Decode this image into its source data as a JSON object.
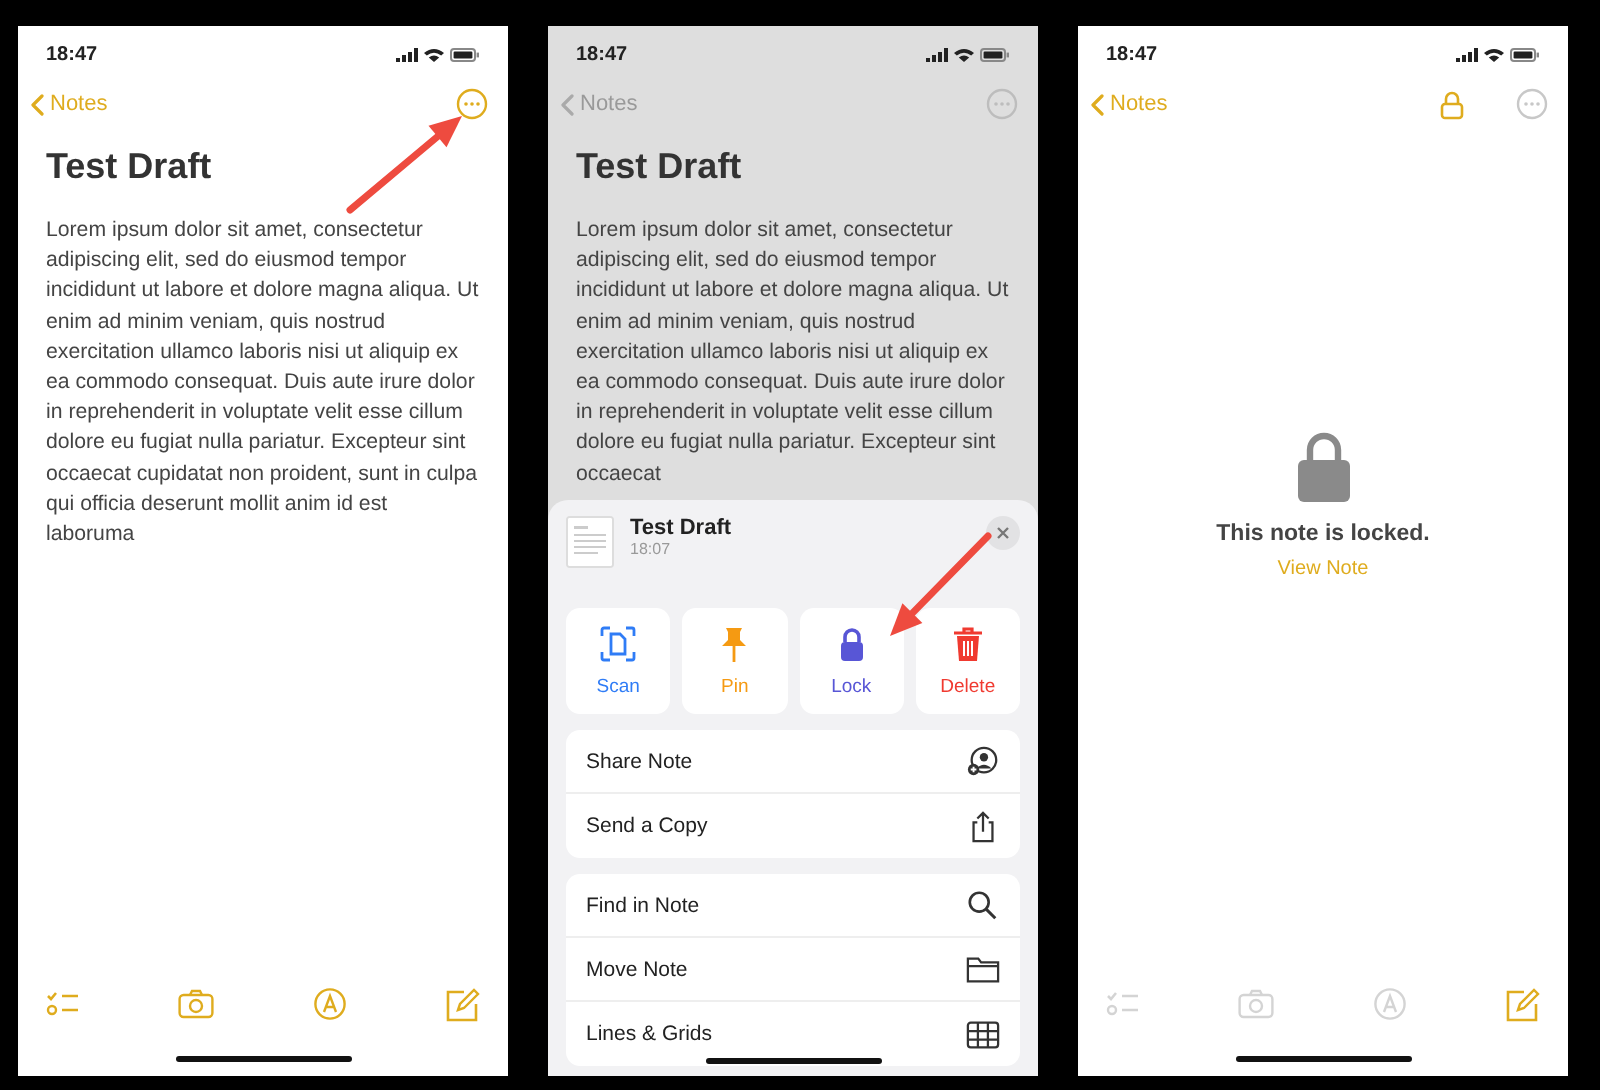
{
  "panels": [
    {
      "kind": "note",
      "dimmed": false,
      "pointer": true,
      "status_time": "18:47",
      "back_label": "Notes",
      "more_disabled": false,
      "title": "Test Draft",
      "body": "Lorem ipsum dolor sit amet, consectetur adipiscing elit, sed do eiusmod tempor incididunt ut labore et dolore magna aliqua. Ut enim ad minim veniam, quis nostrud exercitation ullamco laboris nisi ut aliquip ex ea commodo consequat. Duis aute irure dolor in reprehenderit in voluptate velit esse cillum dolore eu fugiat nulla pariatur. Excepteur sint occaecat cupidatat non proident, sunt in culpa qui officia deserunt mollit anim id est laboruma",
      "toolbar": [
        {
          "disabled": false
        },
        {
          "disabled": false
        },
        {
          "disabled": false
        },
        {
          "disabled": false
        }
      ]
    },
    {
      "kind": "menu",
      "dimmed": true,
      "pointer": true,
      "status_time": "18:47",
      "back_label": "Notes",
      "more_disabled": false,
      "title": "Test Draft",
      "body": "Lorem ipsum dolor sit amet, consectetur adipiscing elit, sed do eiusmod tempor incididunt ut labore et dolore magna aliqua. Ut enim ad minim veniam, quis nostrud exercitation ullamco laboris nisi ut aliquip ex ea commodo consequat. Duis aute irure dolor in reprehenderit in voluptate velit esse cillum dolore eu fugiat nulla pariatur. Excepteur sint occaecat",
      "sheet": {
        "title": "Test Draft",
        "time": "18:07",
        "actions": [
          {
            "label": "Scan",
            "color": "#2f7cf6"
          },
          {
            "label": "Pin",
            "color": "#f59a12"
          },
          {
            "label": "Lock",
            "color": "#5856d6"
          },
          {
            "label": "Delete",
            "color": "#f03a30"
          }
        ],
        "groups": [
          [
            {
              "label": "Share Note"
            },
            {
              "label": "Send a Copy"
            }
          ],
          [
            {
              "label": "Find in Note"
            },
            {
              "label": "Move Note"
            },
            {
              "label": "Lines & Grids"
            }
          ]
        ]
      }
    },
    {
      "kind": "locked",
      "dimmed": false,
      "status_time": "18:47",
      "back_label": "Notes",
      "lock_shown": true,
      "more_disabled": true,
      "message": "This note is locked.",
      "link": "View Note",
      "toolbar": [
        {
          "disabled": true
        },
        {
          "disabled": true
        },
        {
          "disabled": true
        },
        {
          "disabled": false
        }
      ]
    }
  ]
}
